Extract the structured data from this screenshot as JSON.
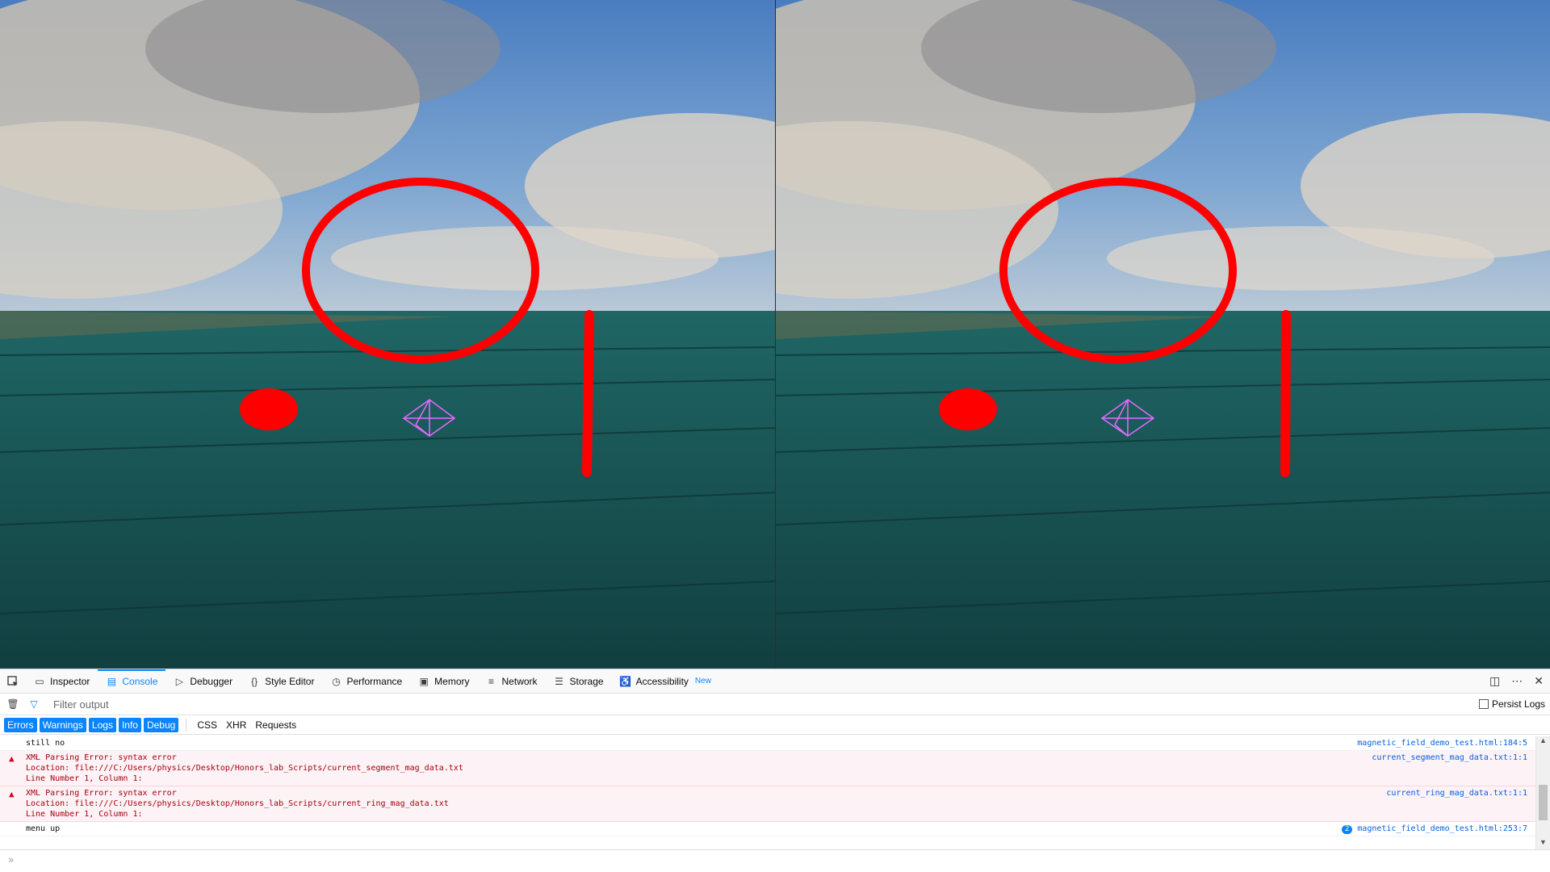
{
  "scene": {
    "colors": {
      "sky_top": "#3f77bf",
      "sky_mid": "#7ea6d4",
      "floor_near": "#14474a",
      "floor_far": "#1c5c5e",
      "accent_red": "#ff0000",
      "wireframe": "#e36cff"
    }
  },
  "devtools": {
    "tabs": [
      {
        "label": "Inspector",
        "icon": "inspector-icon"
      },
      {
        "label": "Console",
        "icon": "console-icon"
      },
      {
        "label": "Debugger",
        "icon": "debugger-icon"
      },
      {
        "label": "Style Editor",
        "icon": "style-editor-icon"
      },
      {
        "label": "Performance",
        "icon": "performance-icon"
      },
      {
        "label": "Memory",
        "icon": "memory-icon"
      },
      {
        "label": "Network",
        "icon": "network-icon"
      },
      {
        "label": "Storage",
        "icon": "storage-icon"
      },
      {
        "label": "Accessibility",
        "icon": "accessibility-icon",
        "badge": "New"
      }
    ],
    "selected_tab": "Console",
    "filter_placeholder": "Filter output",
    "persist_logs": "Persist Logs",
    "levels": [
      "Errors",
      "Warnings",
      "Logs",
      "Info",
      "Debug"
    ],
    "types": [
      "CSS",
      "XHR",
      "Requests"
    ],
    "messages": [
      {
        "kind": "log",
        "text": "still no",
        "location": "magnetic_field_demo_test.html:184:5"
      },
      {
        "kind": "error",
        "text": "XML Parsing Error: syntax error\nLocation: file:///C:/Users/physics/Desktop/Honors_lab_Scripts/current_segment_mag_data.txt\nLine Number 1, Column 1:",
        "location": "current_segment_mag_data.txt:1:1"
      },
      {
        "kind": "error",
        "text": "XML Parsing Error: syntax error\nLocation: file:///C:/Users/physics/Desktop/Honors_lab_Scripts/current_ring_mag_data.txt\nLine Number 1, Column 1:",
        "location": "current_ring_mag_data.txt:1:1"
      },
      {
        "kind": "log",
        "text": "menu up",
        "location": "magnetic_field_demo_test.html:253:7",
        "count": "2"
      }
    ],
    "prompt": "»"
  }
}
